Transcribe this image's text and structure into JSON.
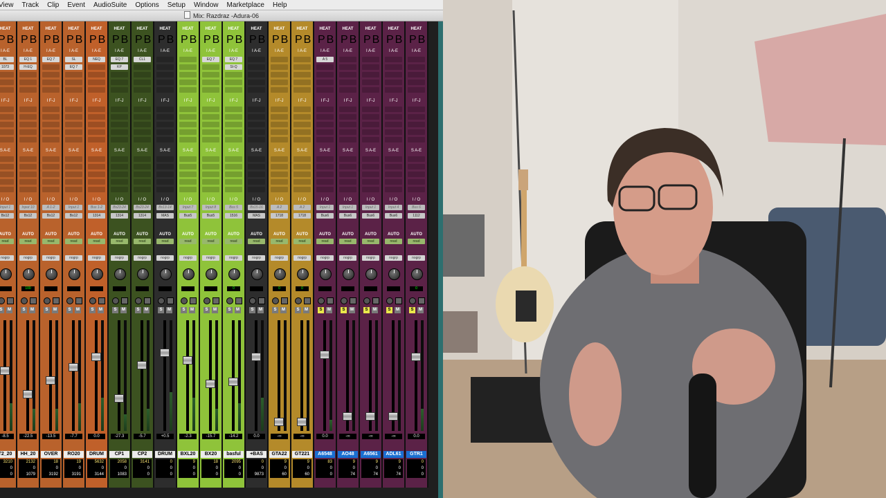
{
  "menubar": {
    "items": [
      "View",
      "Track",
      "Clip",
      "Event",
      "AudioSuite",
      "Options",
      "Setup",
      "Window",
      "Marketplace",
      "Help"
    ]
  },
  "mix_window": {
    "title": "Mix: Razdraz -Adura-06"
  },
  "section_labels": {
    "heat": "HEAT",
    "inserts_ae": "I A-E",
    "inserts_fj": "I F-J",
    "sends_ae": "S A-E",
    "io": "I / O",
    "auto": "AUTO"
  },
  "strip_button_labels": {
    "s": "S",
    "m": "M",
    "p": "P",
    "b": "B"
  },
  "colors": {
    "orange": "#c0602a",
    "dark_green": "#3c5220",
    "gray": "#2d2d2d",
    "lime": "#8fc33a",
    "gold": "#b48a2a",
    "purple": "#5b2247",
    "solo_yellow": "#e9e64b",
    "name_highlight": "#1a6fd1"
  },
  "channels": [
    {
      "name": "T2_20",
      "color": "#b9622c",
      "inserts": [
        "BL",
        "1073"
      ],
      "input": "Input 1",
      "output": "Bs12",
      "automation": "read",
      "group": "nogrp",
      "pan": "",
      "vol": "-8.5",
      "fader": 0.55,
      "meter": 0.25,
      "solo": false,
      "delay": [
        "3210",
        "0",
        "0"
      ]
    },
    {
      "name": "HH_20",
      "color": "#b9622c",
      "inserts": [
        "EQ 1",
        "H-EQ"
      ],
      "input": "Input 10",
      "output": "Bs12",
      "automation": "read",
      "group": "nogrp",
      "pan": "100",
      "vol": "-22.5",
      "fader": 0.32,
      "meter": 0.2,
      "solo": false,
      "delay": [
        "2132",
        "0",
        "1079"
      ]
    },
    {
      "name": "OVER",
      "color": "#b9622c",
      "inserts": [
        "EQ 7"
      ],
      "input": "A 1-2",
      "output": "Bs12",
      "automation": "read",
      "group": "nogrp",
      "pan": "",
      "vol": "-13.5",
      "fader": 0.45,
      "meter": 0.2,
      "solo": false,
      "delay": [
        "18",
        "0",
        "3192"
      ]
    },
    {
      "name": "RO20",
      "color": "#b9622c",
      "inserts": [
        "SL",
        "EQ 7"
      ],
      "input": "Input 1",
      "output": "Bs12",
      "automation": "read",
      "group": "nogrp",
      "pan": "",
      "vol": "-7.7",
      "fader": 0.58,
      "meter": 0.25,
      "solo": false,
      "delay": [
        "19",
        "0",
        "3191"
      ]
    },
    {
      "name": "DRUM",
      "color": "#c0602a",
      "inserts": [
        "NEQ"
      ],
      "input": "Bus 1-2",
      "output": "1314",
      "automation": "read",
      "group": "nogrp",
      "pan": "",
      "vol": "0.0",
      "fader": 0.68,
      "meter": 0.3,
      "solo": false,
      "delay": [
        "5632",
        "0",
        "3144"
      ]
    },
    {
      "name": "CP1",
      "color": "#3c5220",
      "inserts": [
        "EQ 7",
        "KP"
      ],
      "input": "Bs23-24",
      "output": "1314",
      "automation": "read",
      "group": "nogrp",
      "pan": "",
      "vol": "-27.3",
      "fader": 0.28,
      "meter": 0.15,
      "solo": false,
      "delay": [
        "2058",
        "0",
        "1083"
      ]
    },
    {
      "name": "CP2",
      "color": "#3c5220",
      "inserts": [
        "CL1"
      ],
      "input": "Bs23-24",
      "output": "1314",
      "automation": "read",
      "group": "nogrp",
      "pan": "",
      "vol": "-5.7",
      "fader": 0.6,
      "meter": 0.2,
      "solo": false,
      "delay": [
        "3141",
        "0",
        "0"
      ]
    },
    {
      "name": "DRUM",
      "color": "#2d2d2d",
      "inserts": [],
      "input": "Bs13-14",
      "output": "MAS",
      "automation": "read",
      "group": "nogrp",
      "pan": "",
      "vol": "+0.5",
      "fader": 0.72,
      "meter": 0.35,
      "solo": false,
      "delay": [
        "0",
        "0",
        "0"
      ]
    },
    {
      "name": "BXL20",
      "color": "#8fc33a",
      "inserts": [],
      "input": "Input 7",
      "output": "Bus5",
      "automation": "read",
      "group": "nogrp",
      "pan": "",
      "vol": "-2.3",
      "fader": 0.65,
      "meter": 0.3,
      "solo": false,
      "delay": [
        "9",
        "0",
        "0"
      ]
    },
    {
      "name": "BX20",
      "color": "#8fc33a",
      "inserts": [
        "EQ 7"
      ],
      "input": "Input 8",
      "output": "Bus5",
      "automation": "read",
      "group": "nogrp",
      "pan": "",
      "vol": "-15.7",
      "fader": 0.42,
      "meter": 0.2,
      "solo": false,
      "delay": [
        "18",
        "0",
        "0"
      ]
    },
    {
      "name": "basful",
      "color": "#8fc33a",
      "inserts": [
        "EQ 7",
        "SI-Q"
      ],
      "input": "Bus 5",
      "output": "1516",
      "automation": "read",
      "group": "nogrp",
      "pan": "0",
      "vol": "-14.2",
      "fader": 0.44,
      "meter": 0.25,
      "solo": false,
      "delay": [
        "2095",
        "0",
        "0"
      ]
    },
    {
      "name": "+BAS",
      "color": "#2d2d2d",
      "inserts": [],
      "input": "Bs15-16",
      "output": "MAS",
      "automation": "read",
      "group": "nogrp",
      "pan": "",
      "vol": "0.0",
      "fader": 0.68,
      "meter": 0.3,
      "solo": false,
      "delay": [
        "0",
        "0",
        "9873"
      ]
    },
    {
      "name": "GTA22",
      "color": "#b48a2a",
      "inserts": [],
      "input": "A 2",
      "output": "1718",
      "automation": "read",
      "group": "nogrp",
      "pan": "0",
      "vol": "-∞",
      "fader": 0.05,
      "meter": 0.0,
      "solo": false,
      "delay": [
        "9",
        "0",
        "60"
      ]
    },
    {
      "name": "GT221",
      "color": "#b48a2a",
      "inserts": [],
      "input": "A 2",
      "output": "1718",
      "automation": "read",
      "group": "nogrp",
      "pan": "0",
      "vol": "-∞",
      "fader": 0.05,
      "meter": 0.0,
      "solo": false,
      "delay": [
        "9",
        "0",
        "60"
      ]
    },
    {
      "name": "A6548",
      "color": "#5b2247",
      "inserts": [
        "A 5"
      ],
      "input": "Input 1",
      "output": "Bus6",
      "automation": "read",
      "group": "nogrp",
      "pan": "",
      "vol": "0.0",
      "fader": 0.7,
      "meter": 0.1,
      "solo": true,
      "delay": [
        "83",
        "0",
        "0"
      ]
    },
    {
      "name": "AO48",
      "color": "#5b2247",
      "inserts": [],
      "input": "Input 1",
      "output": "Bus6",
      "automation": "read",
      "group": "nogrp",
      "pan": "",
      "vol": "-∞",
      "fader": 0.1,
      "meter": 0.0,
      "solo": true,
      "delay": [
        "9",
        "0",
        "74"
      ]
    },
    {
      "name": "A6561",
      "color": "#5b2247",
      "inserts": [],
      "input": "Input 1",
      "output": "Bus6",
      "automation": "read",
      "group": "nogrp",
      "pan": "",
      "vol": "-∞",
      "fader": 0.1,
      "meter": 0.0,
      "solo": true,
      "delay": [
        "9",
        "0",
        "74"
      ]
    },
    {
      "name": "ADL61",
      "color": "#5b2247",
      "inserts": [],
      "input": "Input 4",
      "output": "Bus6",
      "automation": "read",
      "group": "nogrp",
      "pan": "",
      "vol": "-∞",
      "fader": 0.1,
      "meter": 0.0,
      "solo": true,
      "delay": [
        "9",
        "0",
        "74"
      ]
    },
    {
      "name": "GTR1",
      "color": "#5b2247",
      "inserts": [],
      "input": "Bus 6",
      "output": "1112",
      "automation": "read",
      "group": "nogrp",
      "pan": "0",
      "vol": "0.0",
      "fader": 0.68,
      "meter": 0.2,
      "solo": true,
      "delay": [
        "0",
        "0",
        "0"
      ]
    }
  ],
  "webcam": {
    "description_tag": "presenter-webcam"
  }
}
